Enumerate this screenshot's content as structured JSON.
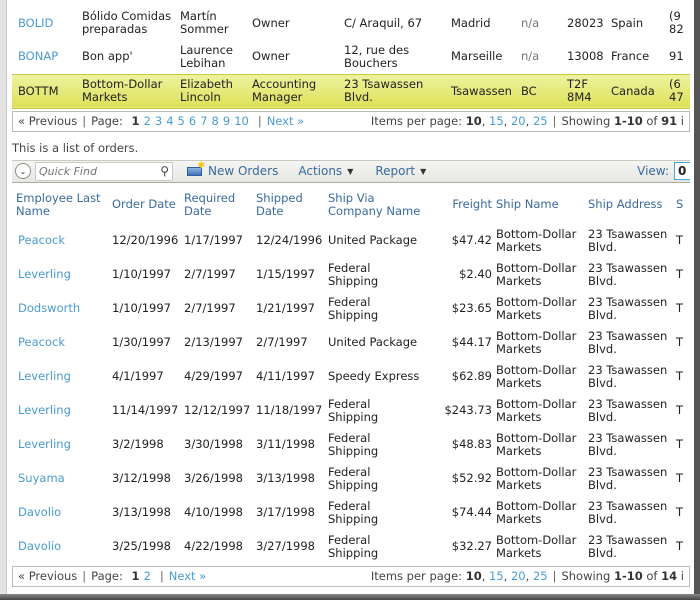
{
  "customers": {
    "rows": [
      {
        "id": "BOLID",
        "company": [
          "Bólido Comidas",
          "preparadas"
        ],
        "contact": [
          "Martín",
          "Sommer"
        ],
        "title": [
          "Owner"
        ],
        "address": [
          "C/ Araquil, 67"
        ],
        "city": "Madrid",
        "region": "n/a",
        "postal": [
          "28023"
        ],
        "country": "Spain",
        "phone": [
          "(9",
          "82"
        ],
        "selected": false
      },
      {
        "id": "BONAP",
        "company": [
          "Bon app'"
        ],
        "contact": [
          "Laurence",
          "Lebihan"
        ],
        "title": [
          "Owner"
        ],
        "address": [
          "12, rue des",
          "Bouchers"
        ],
        "city": "Marseille",
        "region": "n/a",
        "postal": [
          "13008"
        ],
        "country": "France",
        "phone": [
          "91"
        ],
        "selected": false
      },
      {
        "id": "BOTTM",
        "company": [
          "Bottom-Dollar",
          "Markets"
        ],
        "contact": [
          "Elizabeth",
          "Lincoln"
        ],
        "title": [
          "Accounting",
          "Manager"
        ],
        "address": [
          "23 Tsawassen",
          "Blvd."
        ],
        "city": "Tsawassen",
        "region": "BC",
        "postal": [
          "T2F",
          "8M4"
        ],
        "country": "Canada",
        "phone": [
          "(6",
          "47"
        ],
        "selected": true
      }
    ],
    "pager": {
      "previous": "« Previous",
      "page_label": "Page:",
      "current_page": "1",
      "pages": [
        "2",
        "3",
        "4",
        "5",
        "6",
        "7",
        "8",
        "9",
        "10"
      ],
      "next": "Next »",
      "items_per_page_label": "Items per page:",
      "current_size": "10",
      "sizes": [
        "15",
        "20",
        "25"
      ],
      "showing_label": "Showing",
      "range": "1-10",
      "of_label": "of",
      "total": "91",
      "trail": "i"
    }
  },
  "orders": {
    "description": "This is a list of orders.",
    "toolbar": {
      "quick_find_placeholder": "Quick Find",
      "new_label": "New Orders",
      "actions_label": "Actions",
      "report_label": "Report",
      "view_label": "View:",
      "view_value": "0"
    },
    "columns": [
      [
        "Employee Last",
        "Name"
      ],
      [
        "Order Date"
      ],
      [
        "Required",
        "Date"
      ],
      [
        "Shipped",
        "Date"
      ],
      [
        "Ship Via",
        "Company Name"
      ],
      [
        "Freight"
      ],
      [
        "Ship Name"
      ],
      [
        "Ship Address"
      ],
      [
        "S"
      ]
    ],
    "rows": [
      {
        "employee": "Peacock",
        "order_date": "12/20/1996",
        "required": "1/17/1997",
        "shipped": "12/24/1996",
        "ship_via": [
          "United Package"
        ],
        "freight": "$47.42",
        "ship_name": [
          "Bottom-Dollar",
          "Markets"
        ],
        "ship_address": [
          "23 Tsawassen",
          "Blvd."
        ],
        "ship_city": "T"
      },
      {
        "employee": "Leverling",
        "order_date": "1/10/1997",
        "required": "2/7/1997",
        "shipped": "1/15/1997",
        "ship_via": [
          "Federal",
          "Shipping"
        ],
        "freight": "$2.40",
        "ship_name": [
          "Bottom-Dollar",
          "Markets"
        ],
        "ship_address": [
          "23 Tsawassen",
          "Blvd."
        ],
        "ship_city": "T"
      },
      {
        "employee": "Dodsworth",
        "order_date": "1/10/1997",
        "required": "2/7/1997",
        "shipped": "1/21/1997",
        "ship_via": [
          "Federal",
          "Shipping"
        ],
        "freight": "$23.65",
        "ship_name": [
          "Bottom-Dollar",
          "Markets"
        ],
        "ship_address": [
          "23 Tsawassen",
          "Blvd."
        ],
        "ship_city": "T"
      },
      {
        "employee": "Peacock",
        "order_date": "1/30/1997",
        "required": "2/13/1997",
        "shipped": "2/7/1997",
        "ship_via": [
          "United Package"
        ],
        "freight": "$44.17",
        "ship_name": [
          "Bottom-Dollar",
          "Markets"
        ],
        "ship_address": [
          "23 Tsawassen",
          "Blvd."
        ],
        "ship_city": "T"
      },
      {
        "employee": "Leverling",
        "order_date": "4/1/1997",
        "required": "4/29/1997",
        "shipped": "4/11/1997",
        "ship_via": [
          "Speedy Express"
        ],
        "freight": "$62.89",
        "ship_name": [
          "Bottom-Dollar",
          "Markets"
        ],
        "ship_address": [
          "23 Tsawassen",
          "Blvd."
        ],
        "ship_city": "T"
      },
      {
        "employee": "Leverling",
        "order_date": "11/14/1997",
        "required": "12/12/1997",
        "shipped": "11/18/1997",
        "ship_via": [
          "Federal",
          "Shipping"
        ],
        "freight": "$243.73",
        "ship_name": [
          "Bottom-Dollar",
          "Markets"
        ],
        "ship_address": [
          "23 Tsawassen",
          "Blvd."
        ],
        "ship_city": "T"
      },
      {
        "employee": "Leverling",
        "order_date": "3/2/1998",
        "required": "3/30/1998",
        "shipped": "3/11/1998",
        "ship_via": [
          "Federal",
          "Shipping"
        ],
        "freight": "$48.83",
        "ship_name": [
          "Bottom-Dollar",
          "Markets"
        ],
        "ship_address": [
          "23 Tsawassen",
          "Blvd."
        ],
        "ship_city": "T"
      },
      {
        "employee": "Suyama",
        "order_date": "3/12/1998",
        "required": "3/26/1998",
        "shipped": "3/13/1998",
        "ship_via": [
          "Federal",
          "Shipping"
        ],
        "freight": "$52.92",
        "ship_name": [
          "Bottom-Dollar",
          "Markets"
        ],
        "ship_address": [
          "23 Tsawassen",
          "Blvd."
        ],
        "ship_city": "T"
      },
      {
        "employee": "Davolio",
        "order_date": "3/13/1998",
        "required": "4/10/1998",
        "shipped": "3/17/1998",
        "ship_via": [
          "Federal",
          "Shipping"
        ],
        "freight": "$74.44",
        "ship_name": [
          "Bottom-Dollar",
          "Markets"
        ],
        "ship_address": [
          "23 Tsawassen",
          "Blvd."
        ],
        "ship_city": "T"
      },
      {
        "employee": "Davolio",
        "order_date": "3/25/1998",
        "required": "4/22/1998",
        "shipped": "3/27/1998",
        "ship_via": [
          "Federal",
          "Shipping"
        ],
        "freight": "$32.27",
        "ship_name": [
          "Bottom-Dollar",
          "Markets"
        ],
        "ship_address": [
          "23 Tsawassen",
          "Blvd."
        ],
        "ship_city": "T"
      }
    ],
    "pager": {
      "previous": "« Previous",
      "page_label": "Page:",
      "current_page": "1",
      "pages": [
        "2"
      ],
      "next": "Next »",
      "items_per_page_label": "Items per page:",
      "current_size": "10",
      "sizes": [
        "15",
        "20",
        "25"
      ],
      "showing_label": "Showing",
      "range": "1-10",
      "of_label": "of",
      "total": "14",
      "trail": "i"
    }
  },
  "colors": {
    "link": "#4a9bd1",
    "selected_row": "#dde157",
    "toolbar_text": "#3a6a9e"
  }
}
